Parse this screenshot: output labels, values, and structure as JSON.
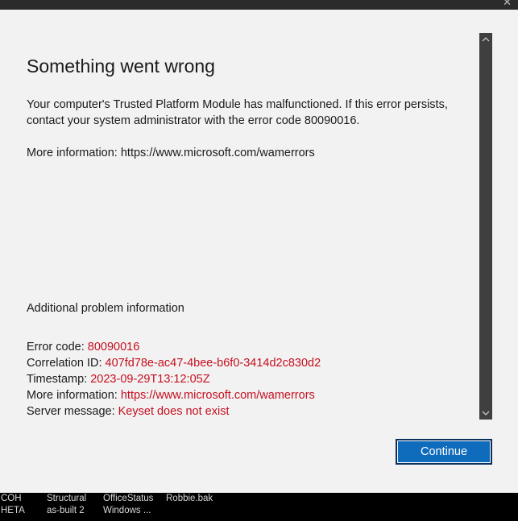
{
  "window": {
    "close_glyph": "✕"
  },
  "dialog": {
    "heading": "Something went wrong",
    "message": "Your computer's Trusted Platform Module has malfunctioned. If this error persists, contact your system administrator with the error code 80090016.",
    "more_info": "More information: https://www.microsoft.com/wamerrors",
    "additional_heading": "Additional problem information",
    "details": {
      "error_code": {
        "label": "Error code: ",
        "value": "80090016"
      },
      "correlation_id": {
        "label": "Correlation ID: ",
        "value": "407fd78e-ac47-4bee-b6f0-3414d2c830d2"
      },
      "timestamp": {
        "label": "Timestamp: ",
        "value": "2023-09-29T13:12:05Z"
      },
      "more_information": {
        "label": "More information: ",
        "value": "https://www.microsoft.com/wamerrors"
      },
      "server_message": {
        "label": "Server message: ",
        "value": "Keyset does not exist"
      }
    },
    "continue_label": "Continue"
  },
  "taskbar": {
    "items": [
      {
        "line1": "COH",
        "line2": "HETA"
      },
      {
        "line1": "Structural",
        "line2": "as-built 2"
      },
      {
        "line1": "OfficeStatus",
        "line2": "Windows ..."
      },
      {
        "line1": "Robbie.bak",
        "line2": ""
      }
    ]
  },
  "colors": {
    "dialog_bg": "#f2f2f2",
    "detail_value": "#c50f1f",
    "button_bg": "#0f6cbd",
    "scrollbar": "#3f3f3f"
  },
  "icons": {
    "scroll_up": "chevron-up-icon",
    "scroll_down": "chevron-down-icon"
  }
}
